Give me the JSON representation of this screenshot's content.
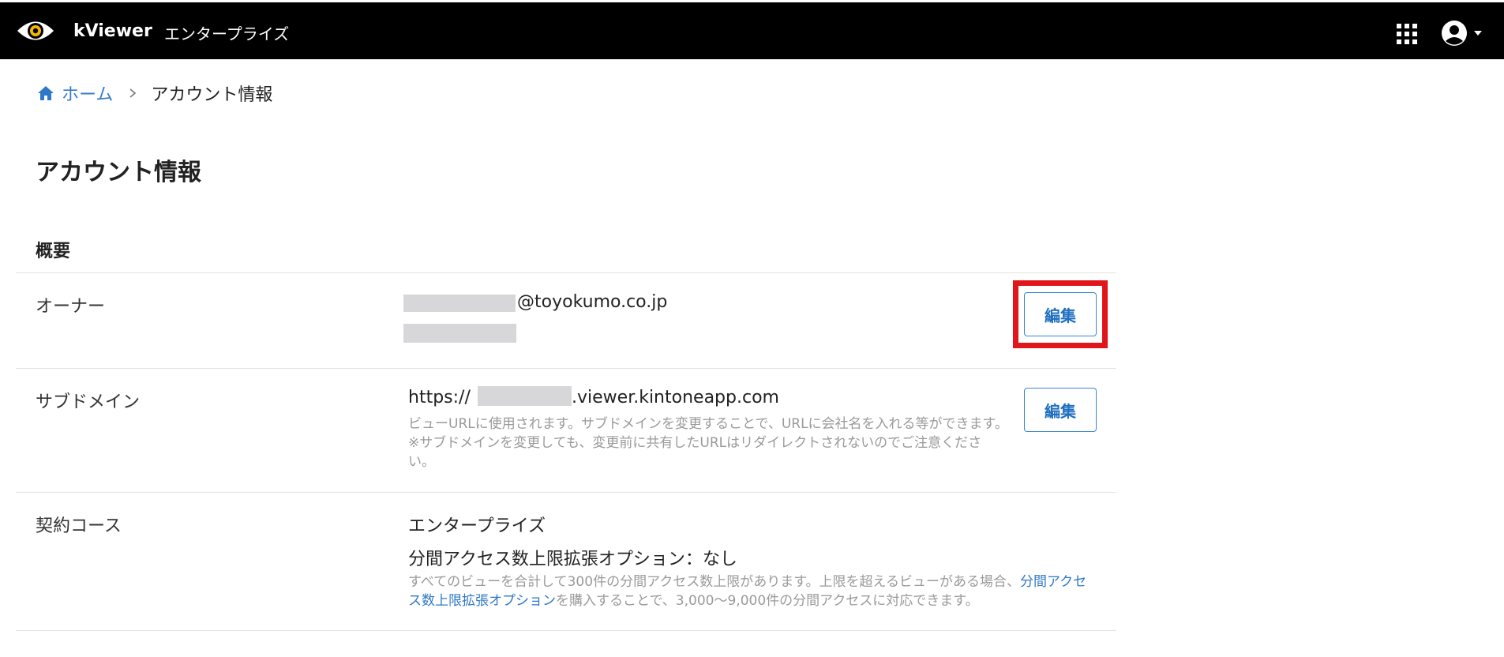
{
  "header": {
    "app_name": "kViewer",
    "edition": "エンタープライズ",
    "icons": {
      "logo": "eye-logo-icon",
      "apps": "apps-grid-icon",
      "account": "account-circle-icon",
      "dropdown": "caret-down-icon"
    },
    "logo_accent_color": "#f5b800"
  },
  "breadcrumb": {
    "home_label": "ホーム",
    "current_label": "アカウント情報",
    "link_color": "#3a7cc6"
  },
  "page": {
    "title": "アカウント情報",
    "section_title": "概要"
  },
  "rows": {
    "owner": {
      "label": "オーナー",
      "email_suffix": "@toyokumo.co.jp",
      "edit_label": "編集"
    },
    "subdomain": {
      "label": "サブドメイン",
      "url_prefix": "https://",
      "url_suffix": ".viewer.kintoneapp.com",
      "note": "ビューURLに使用されます。サブドメインを変更することで、URLに会社名を入れる等ができます。 ※サブドメインを変更しても、変更前に共有したURLはリダイレクトされないのでご注意ください。",
      "edit_label": "編集"
    },
    "plan": {
      "label": "契約コース",
      "value": "エンタープライズ",
      "option_value": "分間アクセス数上限拡張オプション：なし",
      "note_before_link": "すべてのビューを合計して300件の分間アクセス数上限があります。上限を超えるビューがある場合、",
      "note_link": "分間アクセス数上限拡張オプション",
      "note_after_link": "を購入することで、3,000〜9,000件の分間アクセスに対応できます。"
    }
  },
  "colors": {
    "accent_blue": "#1f6fc0",
    "highlight_red": "#e0161b",
    "header_bg": "#000000"
  }
}
